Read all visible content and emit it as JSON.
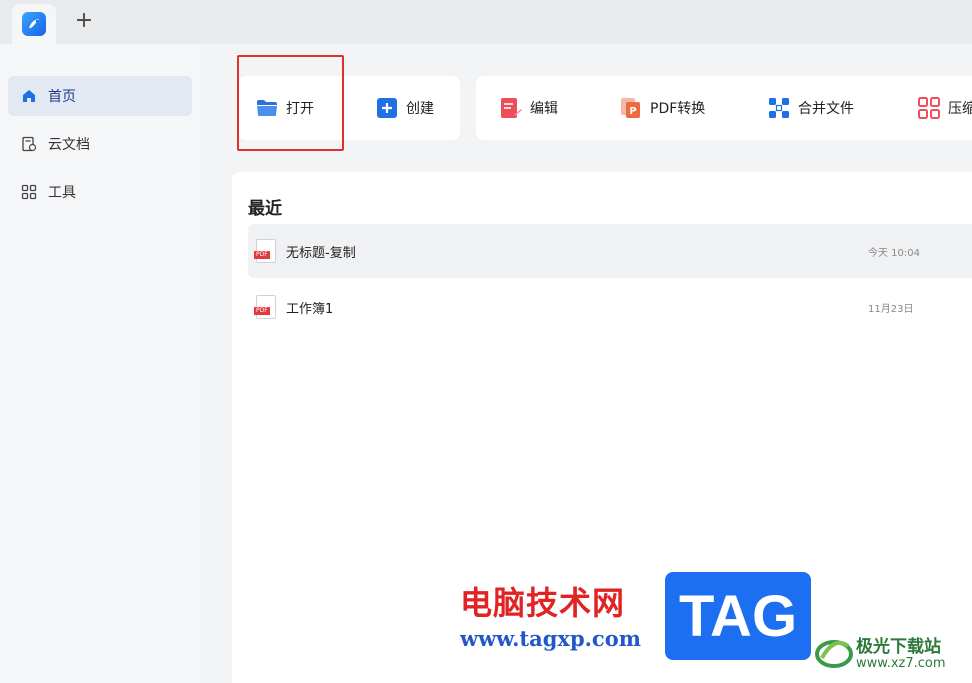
{
  "tabs": {
    "new_tab_symbol": "+"
  },
  "sidebar": {
    "items": [
      {
        "label": "首页",
        "icon": "home-icon",
        "active": true
      },
      {
        "label": "云文档",
        "icon": "cloud-doc-icon",
        "active": false
      },
      {
        "label": "工具",
        "icon": "tools-grid-icon",
        "active": false
      }
    ]
  },
  "quick_actions": {
    "open": "打开",
    "create": "创建",
    "edit": "编辑",
    "pdf_convert": "PDF转换",
    "merge": "合并文件",
    "compress": "压缩"
  },
  "recent": {
    "title": "最近",
    "files": [
      {
        "name": "无标题-复制",
        "time": "今天 10:04",
        "badge": "PDF"
      },
      {
        "name": "工作簿1",
        "time": "11月23日",
        "badge": "PDF"
      }
    ]
  },
  "watermark": {
    "cn": "电脑技术网",
    "url": "www.tagxp.com",
    "tag": "TAG",
    "site": "极光下载站",
    "site_url": "www.xz7.com"
  },
  "colors": {
    "accent": "#1f6fe5",
    "highlight_border": "#e12e2e",
    "sidebar_active_bg": "#e3e9f3"
  }
}
